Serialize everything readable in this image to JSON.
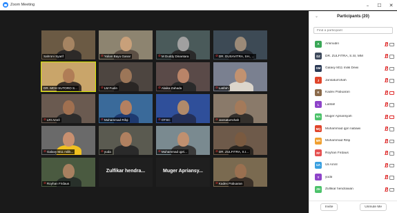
{
  "window": {
    "title": "Zoom Meeting",
    "controls": {
      "minimize": "–",
      "maximize": "☐",
      "close": "✕"
    }
  },
  "gallery": {
    "tiles": [
      {
        "name": "Sahroni Syarif",
        "mic_off": false,
        "video": true,
        "active": false
      },
      {
        "name": "Yulian Bayu Ganar",
        "mic_off": true,
        "video": true,
        "active": false
      },
      {
        "name": "M Duddy Dinantara",
        "mic_off": true,
        "video": true,
        "active": false
      },
      {
        "name": "DR. DUSAVITRA, SH., ...",
        "mic_off": true,
        "video": true,
        "active": false
      },
      {
        "name": "DR. MOH SUTORO S...",
        "mic_off": false,
        "video": true,
        "active": true
      },
      {
        "name": "LM Fudin",
        "mic_off": true,
        "video": true,
        "active": false
      },
      {
        "name": "Alaika Zahada",
        "mic_off": true,
        "video": true,
        "active": false
      },
      {
        "name": "Latifah",
        "mic_off": true,
        "video": true,
        "active": false
      },
      {
        "name": "LRI Amril",
        "mic_off": true,
        "video": true,
        "active": false
      },
      {
        "name": "Muhammad Rifqi",
        "mic_off": true,
        "video": true,
        "active": false
      },
      {
        "name": "OTSC",
        "mic_off": true,
        "video": true,
        "active": false
      },
      {
        "name": "Jansaturrohah",
        "mic_off": true,
        "video": true,
        "active": false
      },
      {
        "name": "Galavy M11 milik...",
        "mic_off": true,
        "video": true,
        "active": false
      },
      {
        "name": "yuda",
        "mic_off": true,
        "video": true,
        "active": false
      },
      {
        "name": "Muhammad qpri...",
        "mic_off": true,
        "video": true,
        "active": false
      },
      {
        "name": "DR. ZULFITRA, S.I...",
        "mic_off": true,
        "video": true,
        "active": false
      },
      {
        "name": "Royhan Firdaus",
        "mic_off": true,
        "video": true,
        "active": false
      },
      {
        "name": "Zulfikar hendra...",
        "mic_off": false,
        "video": false,
        "active": false
      },
      {
        "name": "Muger Apriansy...",
        "mic_off": false,
        "video": false,
        "active": false
      },
      {
        "name": "Kadex Pabuaran",
        "mic_off": true,
        "video": true,
        "active": false
      }
    ]
  },
  "panel": {
    "title": "Participants (20)",
    "collapse_icon": "chevron-down-icon",
    "search_placeholder": "Find a participant",
    "participants": [
      {
        "initials": "A",
        "name": "Aminudin",
        "color": "#3aa757",
        "cam_off": false
      },
      {
        "initials": "DZ",
        "name": "DR. ZULFITRA, S.SI, MM",
        "color": "#3e4a5c",
        "cam_off": false
      },
      {
        "initials": "GM",
        "name": "Galavy M11 milik Dewi",
        "color": "#2b3a55",
        "cam_off": false
      },
      {
        "initials": "J",
        "name": "Jansaturrohah",
        "color": "#e0452b",
        "cam_off": false
      },
      {
        "initials": "K",
        "name": "Kadex Pabuaran",
        "color": "#8a6a4a",
        "cam_off": true
      },
      {
        "initials": "L",
        "name": "Latifah",
        "color": "#8e44c9",
        "cam_off": false
      },
      {
        "initials": "MA",
        "name": "Muger Apriansyah",
        "color": "#4cc26a",
        "cam_off": true
      },
      {
        "initials": "MQ",
        "name": "Muhammad qpri nabawi",
        "color": "#e0452b",
        "cam_off": false
      },
      {
        "initials": "MR",
        "name": "Muhammad Rifqi",
        "color": "#f0a030",
        "cam_off": false
      },
      {
        "initials": "RF",
        "name": "Royhan Firdaus",
        "color": "#e55050",
        "cam_off": false
      },
      {
        "initials": "UA",
        "name": "Uli Amril",
        "color": "#3aa0e0",
        "cam_off": false
      },
      {
        "initials": "Y",
        "name": "yuda",
        "color": "#8e44c9",
        "cam_off": false
      },
      {
        "initials": "ZH",
        "name": "Zulfikar hendrawan",
        "color": "#4cc26a",
        "cam_off": false
      }
    ],
    "invite_label": "Invite",
    "unmute_label": "Unmute Me"
  },
  "colors": {
    "accent": "#2d8cff",
    "active_speaker": "#d6e600",
    "muted": "#e03030"
  }
}
